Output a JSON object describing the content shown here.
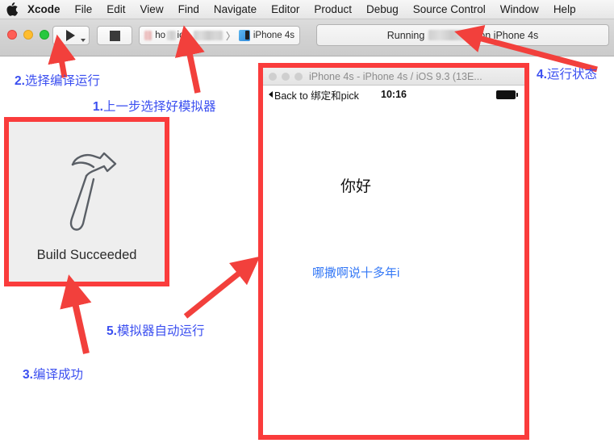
{
  "menubar": {
    "apple_icon": "apple-logo-icon",
    "items": [
      {
        "label": "Xcode",
        "bold": true
      },
      {
        "label": "File"
      },
      {
        "label": "Edit"
      },
      {
        "label": "View"
      },
      {
        "label": "Find"
      },
      {
        "label": "Navigate"
      },
      {
        "label": "Editor"
      },
      {
        "label": "Product"
      },
      {
        "label": "Debug"
      },
      {
        "label": "Source Control"
      },
      {
        "label": "Window"
      },
      {
        "label": "Help"
      }
    ]
  },
  "toolbar": {
    "run_button": "run-button",
    "stop_button": "stop-button",
    "scheme": {
      "project_visible_text": "ho",
      "project_visible_text_2": "ios-",
      "separator": "〉",
      "destination": "iPhone 4s"
    },
    "status": {
      "prefix": "Running",
      "suffix": "on iPhone 4s"
    }
  },
  "build_hud": {
    "icon": "hammer-icon",
    "label": "Build Succeeded"
  },
  "simulator": {
    "window_title": "iPhone 4s - iPhone 4s / iOS 9.3 (13E...",
    "status_bar": {
      "back_label": "Back to 绑定和pick",
      "time": "10:16",
      "battery": "battery-full-icon"
    },
    "screen": {
      "hello_text": "你好",
      "blue_text": "哪撒啊说十多年i"
    }
  },
  "annotations": [
    {
      "id": "2",
      "num": "2.",
      "text": "选择编译运行"
    },
    {
      "id": "1",
      "num": "1.",
      "text": "上一步选择好模拟器"
    },
    {
      "id": "4",
      "num": "4.",
      "text": "运行状态"
    },
    {
      "id": "5",
      "num": "5.",
      "text": "模拟器自动运行"
    },
    {
      "id": "3",
      "num": "3.",
      "text": "编译成功"
    }
  ],
  "colors": {
    "annotation_text": "#3b4ff0",
    "annotation_box": "#fa3c3c",
    "arrow": "#f2403c",
    "ios_link": "#3478f6"
  }
}
